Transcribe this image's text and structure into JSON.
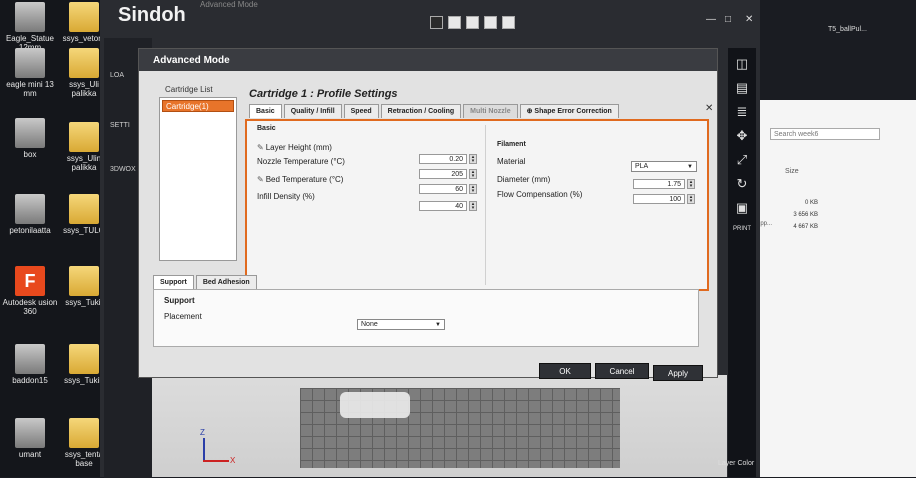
{
  "desktop": {
    "icons": [
      {
        "label": "Eagle_Statue 12mm",
        "kind": "stl"
      },
      {
        "label": "ssys_vetore",
        "kind": "folder"
      },
      {
        "label": "eagle mini 13 mm",
        "kind": "stl"
      },
      {
        "label": "ssys_Uli palikka",
        "kind": "folder"
      },
      {
        "label": "box",
        "kind": "stl"
      },
      {
        "label": "ssys_Ulin palikka",
        "kind": "folder"
      },
      {
        "label": "petonilaatta",
        "kind": "stl"
      },
      {
        "label": "ssys_TULO",
        "kind": "folder"
      },
      {
        "label": "Autodesk usion 360",
        "kind": "app"
      },
      {
        "label": "ssys_Tukit",
        "kind": "folder"
      },
      {
        "label": "baddon15",
        "kind": "stl"
      },
      {
        "label": "ssys_Tukih",
        "kind": "folder"
      },
      {
        "label": "umant",
        "kind": "stl"
      },
      {
        "label": "ssys_tenta base",
        "kind": "folder"
      }
    ]
  },
  "app": {
    "title": "Sindoh",
    "top_label": "Advanced Mode",
    "sidebar": {
      "load": "LOA",
      "settings": "SETTI",
      "printer": "3DWOX"
    },
    "print_label": "PRINT",
    "layer_label": "Layer\nColor"
  },
  "background": {
    "file_label": "T5_ballPul...",
    "search_placeholder": "Search week6",
    "size_header": "Size",
    "sizes": [
      "0 KB",
      "3 656 KB",
      "4 667 KB"
    ],
    "snippet": "ripp..."
  },
  "dialog": {
    "title": "Advanced Mode",
    "cartridge_list_label": "Cartridge List",
    "cartridge_item": "Cartridge(1)",
    "profile_title": "Cartridge 1 : Profile Settings",
    "tabs": [
      "Basic",
      "Quality / Infill",
      "Speed",
      "Retraction / Cooling",
      "Multi Nozzle",
      "Shape Error Correction"
    ],
    "basic": {
      "section": "Basic",
      "layer_height_label": "Layer Height (mm)",
      "layer_height": "0.20",
      "nozzle_temp_label": "Nozzle Temperature (°C)",
      "nozzle_temp": "205",
      "bed_temp_label": "Bed Temperature (°C)",
      "bed_temp": "60",
      "infill_label": "Infill Density (%)",
      "infill": "40"
    },
    "filament": {
      "section": "Filament",
      "material_label": "Material",
      "material": "PLA",
      "diameter_label": "Diameter (mm)",
      "diameter": "1.75",
      "flow_label": "Flow Compensation (%)",
      "flow": "100"
    },
    "support_tabs": [
      "Support",
      "Bed Adhesion"
    ],
    "support": {
      "section": "Support",
      "placement_label": "Placement",
      "placement": "None"
    },
    "buttons": {
      "ok": "OK",
      "cancel": "Cancel",
      "apply": "Apply"
    }
  },
  "axis": {
    "z": "Z",
    "x": "X"
  }
}
